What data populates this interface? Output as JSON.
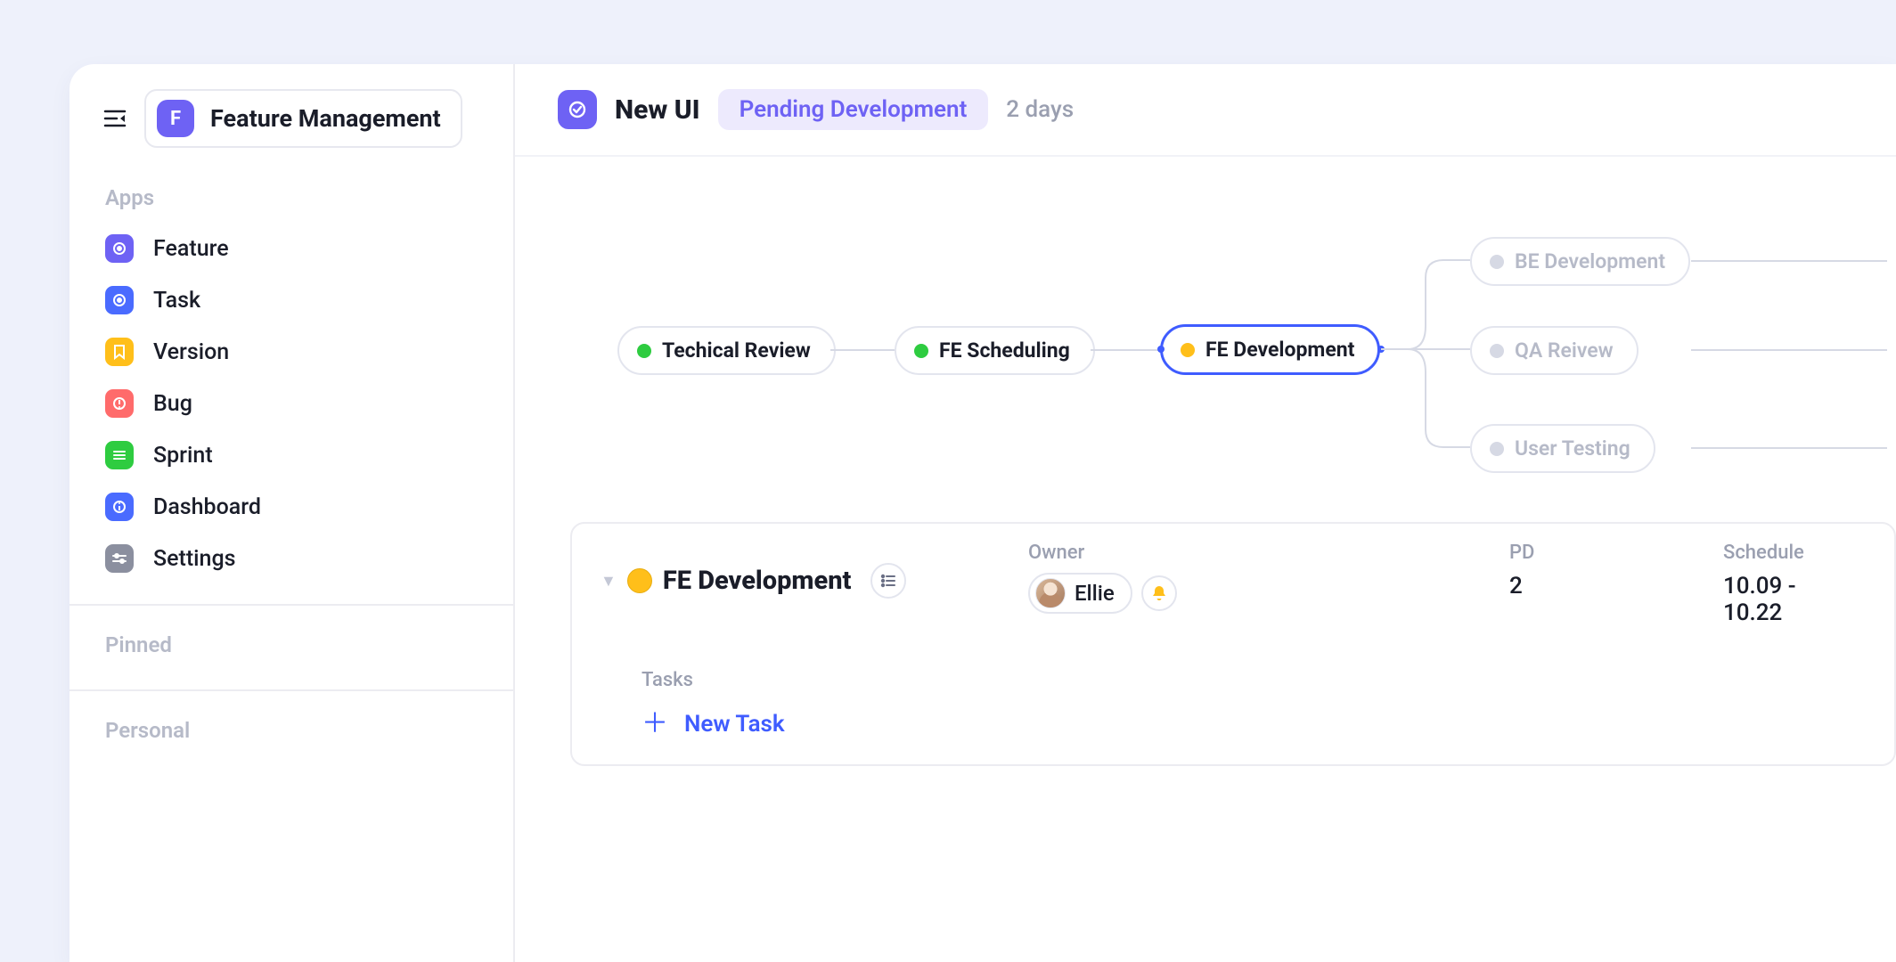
{
  "sidebar": {
    "workspace_letter": "F",
    "workspace_name": "Feature Management",
    "section_apps_label": "Apps",
    "items": [
      {
        "label": "Feature",
        "icon_bg": "#6e62f4",
        "icon": "target"
      },
      {
        "label": "Task",
        "icon_bg": "#4a6bff",
        "icon": "target"
      },
      {
        "label": "Version",
        "icon_bg": "#ffbf1a",
        "icon": "bookmark"
      },
      {
        "label": "Bug",
        "icon_bg": "#ff6b6b",
        "icon": "alert"
      },
      {
        "label": "Sprint",
        "icon_bg": "#2ecc40",
        "icon": "list"
      },
      {
        "label": "Dashboard",
        "icon_bg": "#4a6bff",
        "icon": "info"
      },
      {
        "label": "Settings",
        "icon_bg": "#8b8f9f",
        "icon": "sliders"
      }
    ],
    "section_pinned_label": "Pinned",
    "section_personal_label": "Personal"
  },
  "header": {
    "title": "New UI",
    "status": "Pending Development",
    "duration": "2 days"
  },
  "flow": {
    "nodes": [
      {
        "label": "Techical Review",
        "state": "done"
      },
      {
        "label": "FE Scheduling",
        "state": "done"
      },
      {
        "label": "FE Development",
        "state": "current"
      },
      {
        "label": "BE Development",
        "state": "pending"
      },
      {
        "label": "QA Reivew",
        "state": "pending"
      },
      {
        "label": "User Testing",
        "state": "pending"
      }
    ]
  },
  "detail": {
    "title": "FE Development",
    "columns": {
      "owner_label": "Owner",
      "owner_name": "Ellie",
      "pd_label": "PD",
      "pd_value": "2",
      "schedule_label": "Schedule",
      "schedule_value": "10.09 - 10.22"
    },
    "tasks_label": "Tasks",
    "new_task_label": "New Task"
  },
  "colors": {
    "accent": "#6e62f4",
    "blue": "#3f5cff",
    "green": "#2ecc40",
    "amber": "#ffbf1a",
    "grey": "#d6d9e4"
  }
}
